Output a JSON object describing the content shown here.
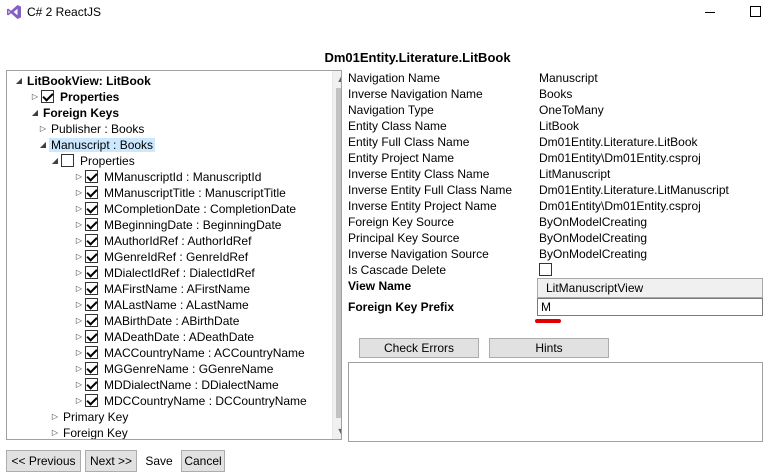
{
  "window": {
    "title": "C# 2 ReactJS",
    "icon": "visual-studio-icon"
  },
  "entity_title": "Dm01Entity.Literature.LitBook",
  "tree": [
    {
      "label": "LitBookView: LitBook",
      "level": 0,
      "expander": "open",
      "checkbox": null,
      "bold": true,
      "selected": false
    },
    {
      "label": "Properties",
      "level": 1,
      "expander": "closed",
      "checkbox": true,
      "bold": true,
      "selected": false
    },
    {
      "label": "Foreign Keys",
      "level": 1,
      "expander": "open",
      "checkbox": null,
      "bold": true,
      "selected": false
    },
    {
      "label": "Publisher : Books",
      "level": 2,
      "expander": "closed",
      "checkbox": null,
      "bold": false,
      "selected": false
    },
    {
      "label": "Manuscript : Books",
      "level": 2,
      "expander": "open",
      "checkbox": null,
      "bold": false,
      "selected": true
    },
    {
      "label": "Properties",
      "level": 3,
      "expander": "open",
      "checkbox": false,
      "bold": false,
      "selected": false
    },
    {
      "label": "MManuscriptId : ManuscriptId",
      "level": 4,
      "expander": "closed",
      "checkbox": true,
      "bold": false,
      "selected": false
    },
    {
      "label": "MManuscriptTitle : ManuscriptTitle",
      "level": 4,
      "expander": "closed",
      "checkbox": true,
      "bold": false,
      "selected": false
    },
    {
      "label": "MCompletionDate : CompletionDate",
      "level": 4,
      "expander": "closed",
      "checkbox": true,
      "bold": false,
      "selected": false
    },
    {
      "label": "MBeginningDate : BeginningDate",
      "level": 4,
      "expander": "closed",
      "checkbox": true,
      "bold": false,
      "selected": false
    },
    {
      "label": "MAuthorIdRef : AuthorIdRef",
      "level": 4,
      "expander": "closed",
      "checkbox": true,
      "bold": false,
      "selected": false
    },
    {
      "label": "MGenreIdRef : GenreIdRef",
      "level": 4,
      "expander": "closed",
      "checkbox": true,
      "bold": false,
      "selected": false
    },
    {
      "label": "MDialectIdRef : DialectIdRef",
      "level": 4,
      "expander": "closed",
      "checkbox": true,
      "bold": false,
      "selected": false
    },
    {
      "label": "MAFirstName : AFirstName",
      "level": 4,
      "expander": "closed",
      "checkbox": true,
      "bold": false,
      "selected": false
    },
    {
      "label": "MALastName : ALastName",
      "level": 4,
      "expander": "closed",
      "checkbox": true,
      "bold": false,
      "selected": false
    },
    {
      "label": "MABirthDate : ABirthDate",
      "level": 4,
      "expander": "closed",
      "checkbox": true,
      "bold": false,
      "selected": false
    },
    {
      "label": "MADeathDate : ADeathDate",
      "level": 4,
      "expander": "closed",
      "checkbox": true,
      "bold": false,
      "selected": false
    },
    {
      "label": "MACCountryName : ACCountryName",
      "level": 4,
      "expander": "closed",
      "checkbox": true,
      "bold": false,
      "selected": false
    },
    {
      "label": "MGGenreName : GGenreName",
      "level": 4,
      "expander": "closed",
      "checkbox": true,
      "bold": false,
      "selected": false
    },
    {
      "label": "MDDialectName : DDialectName",
      "level": 4,
      "expander": "closed",
      "checkbox": true,
      "bold": false,
      "selected": false
    },
    {
      "label": "MDCCountryName : DCCountryName",
      "level": 4,
      "expander": "closed",
      "checkbox": true,
      "bold": false,
      "selected": false
    },
    {
      "label": "Primary Key",
      "level": 3,
      "expander": "closed",
      "checkbox": null,
      "bold": false,
      "selected": false
    },
    {
      "label": "Foreign Key",
      "level": 3,
      "expander": "closed",
      "checkbox": null,
      "bold": false,
      "selected": false
    }
  ],
  "properties": [
    {
      "key": "Navigation Name",
      "value": "Manuscript"
    },
    {
      "key": "Inverse Navigation Name",
      "value": "Books"
    },
    {
      "key": "Navigation Type",
      "value": "OneToMany"
    },
    {
      "key": "Entity Class Name",
      "value": "LitBook"
    },
    {
      "key": "Entity Full Class Name",
      "value": "Dm01Entity.Literature.LitBook"
    },
    {
      "key": "Entity Project Name",
      "value": "Dm01Entity\\Dm01Entity.csproj"
    },
    {
      "key": "Inverse Entity Class Name",
      "value": "LitManuscript"
    },
    {
      "key": "Inverse Entity Full Class Name",
      "value": "Dm01Entity.Literature.LitManuscript"
    },
    {
      "key": "Inverse Entity Project Name",
      "value": "Dm01Entity\\Dm01Entity.csproj"
    },
    {
      "key": "Foreign Key Source",
      "value": "ByOnModelCreating"
    },
    {
      "key": "Principal Key Source",
      "value": "ByOnModelCreating"
    },
    {
      "key": "Inverse Navigation Source",
      "value": "ByOnModelCreating"
    }
  ],
  "cascade_delete": {
    "label": "Is Cascade Delete",
    "checked": false
  },
  "view_name": {
    "label": "View Name",
    "value": "LitManuscriptView"
  },
  "fk_prefix": {
    "label": "Foreign Key Prefix",
    "value": "M"
  },
  "buttons": {
    "check_errors": "Check Errors",
    "hints": "Hints",
    "previous": "<< Previous",
    "next": "Next >>",
    "save": "Save",
    "cancel": "Cancel"
  },
  "colors": {
    "selection": "#cce8ff",
    "error_underline": "#e00000",
    "vs_purple": "#865fc5"
  }
}
